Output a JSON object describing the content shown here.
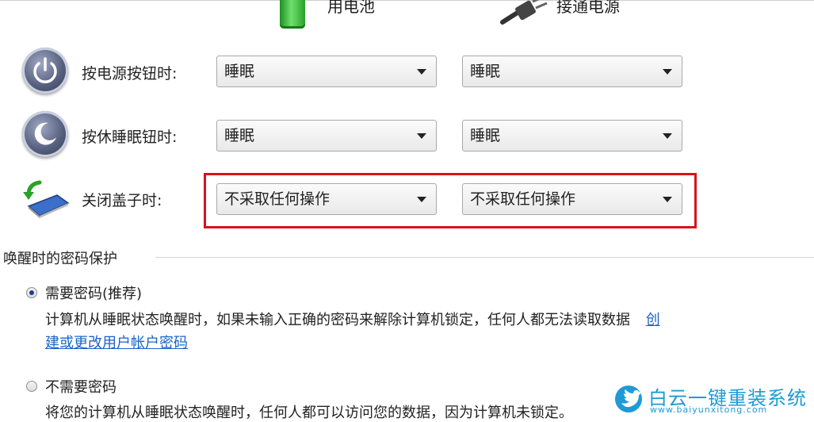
{
  "columns": {
    "battery_label": "用电池",
    "plugged_label": "接通电源"
  },
  "rows": [
    {
      "label": "按电源按钮时:",
      "battery_value": "睡眠",
      "plugged_value": "睡眠",
      "icon": "power-button-icon"
    },
    {
      "label": "按休睡眠钮时:",
      "battery_value": "睡眠",
      "plugged_value": "睡眠",
      "icon": "sleep-button-icon"
    },
    {
      "label": "关闭盖子时:",
      "battery_value": "不采取任何操作",
      "plugged_value": "不采取任何操作",
      "icon": "laptop-lid-icon"
    }
  ],
  "password_section": {
    "title": "唤醒时的密码保护",
    "option_required": {
      "label": "需要密码(推荐)",
      "selected": true,
      "description_line1": "计算机从睡眠状态唤醒时，如果未输入正确的密码来解除计算机锁定，任何人都无法读取数据",
      "link_part1": "创",
      "link_part2": "建或更改用户帐户密码"
    },
    "option_not_required": {
      "label": "不需要密码",
      "selected": false,
      "description": "将您的计算机从睡眠状态唤醒时，任何人都可以访问您的数据，因为计算机未锁定。"
    }
  },
  "watermark": {
    "name": "白云一键重装系统",
    "url": "www.baiyunxitong.com"
  },
  "colors": {
    "highlight": "#d8121b",
    "link": "#1a63c8",
    "watermark": "#1f9ad6"
  }
}
